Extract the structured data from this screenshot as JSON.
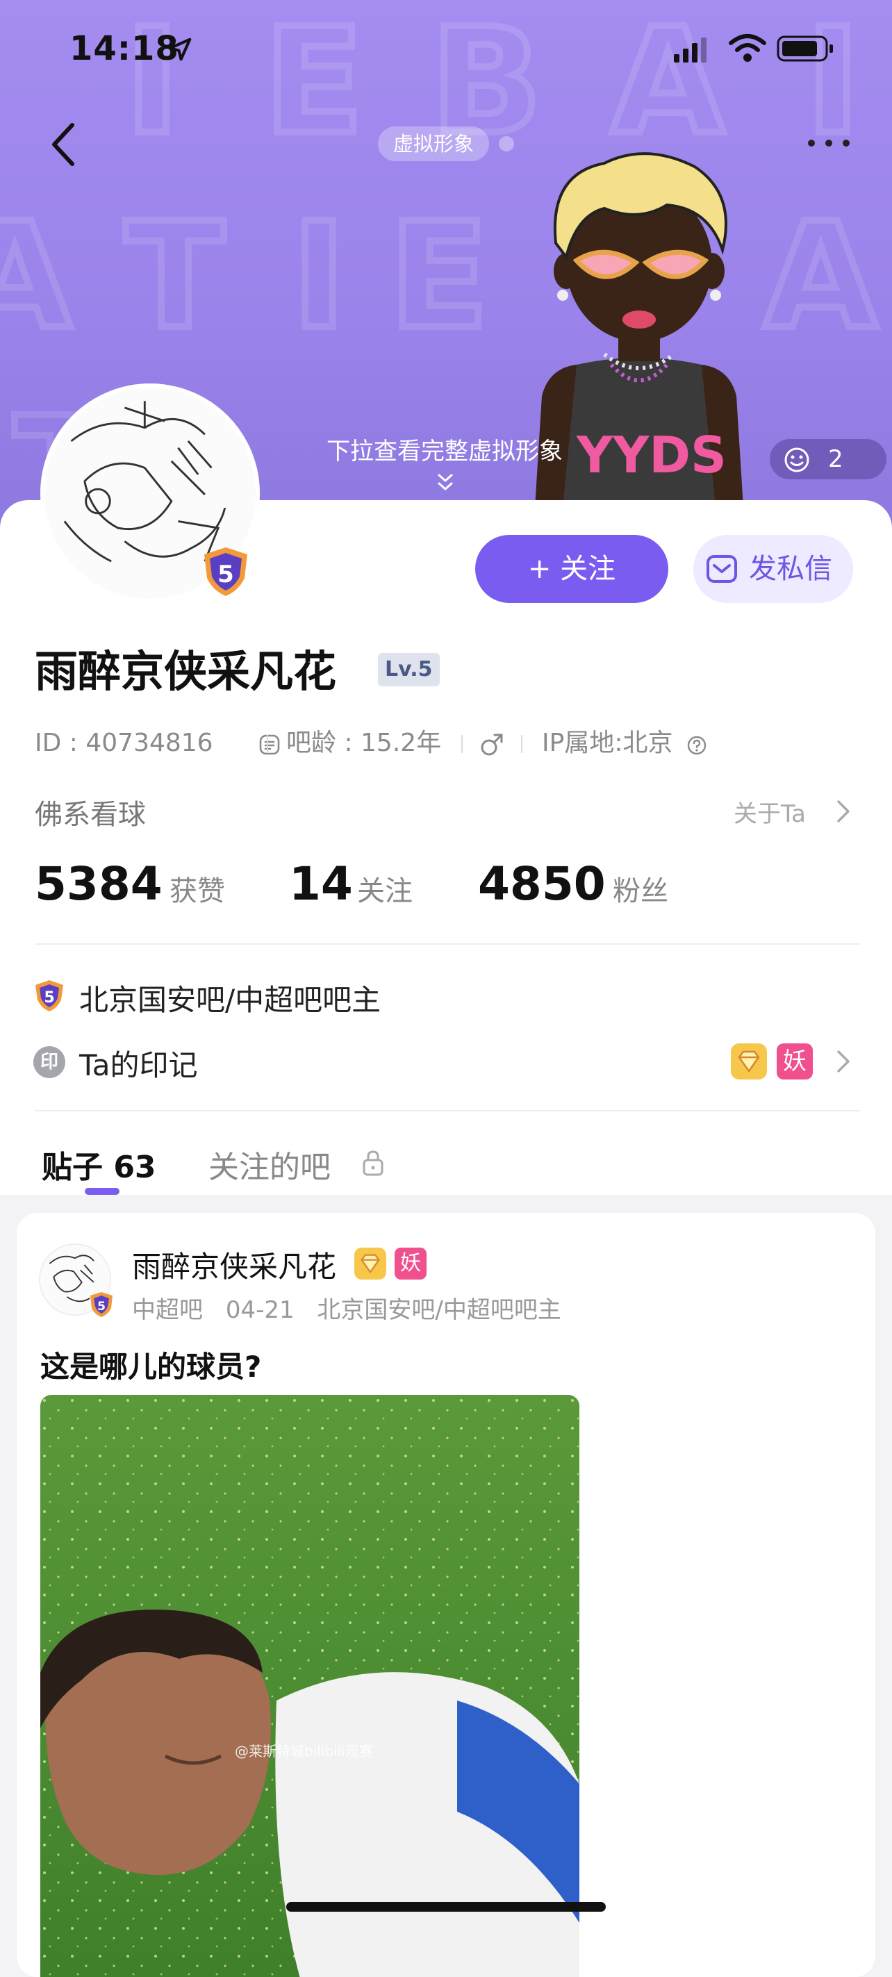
{
  "status_bar": {
    "time": "14:18"
  },
  "header": {
    "avatar_pill": "虚拟形象",
    "pull_hint": "下拉查看完整虚拟形象",
    "like_count": "2",
    "shirt_text": "YYDS"
  },
  "profile": {
    "username": "雨醉京侠采凡花",
    "level": "Lv.5",
    "follow_label": "+ 关注",
    "dm_label": "发私信",
    "id_text": "ID : 40734816",
    "age_text": "吧龄 : 15.2年",
    "ip_text": "IP属地:北京",
    "bio": "佛系看球",
    "about_label": "关于Ta",
    "badge_level": "5"
  },
  "stats": [
    {
      "value": "5384",
      "label": "获赞"
    },
    {
      "value": "14",
      "label": "关注"
    },
    {
      "value": "4850",
      "label": "粉丝"
    }
  ],
  "honor": {
    "text": "北京国安吧/中超吧吧主"
  },
  "marks": {
    "icon_char": "印",
    "label": "Ta的印记",
    "yao": "妖"
  },
  "tabs": {
    "posts": "贴子 63",
    "followed_bars": "关注的吧"
  },
  "post": {
    "author": "雨醉京侠采凡花",
    "yao": "妖",
    "bar": "中超吧",
    "date": "04-21",
    "role": "北京国安吧/中超吧吧主",
    "title": "这是哪儿的球员?",
    "watermark": "@莱斯特城bilibili观赛"
  },
  "colors": {
    "accent": "#7b5cf0",
    "hero_bg": "#a48cf0",
    "yao_badge": "#f0508e"
  }
}
